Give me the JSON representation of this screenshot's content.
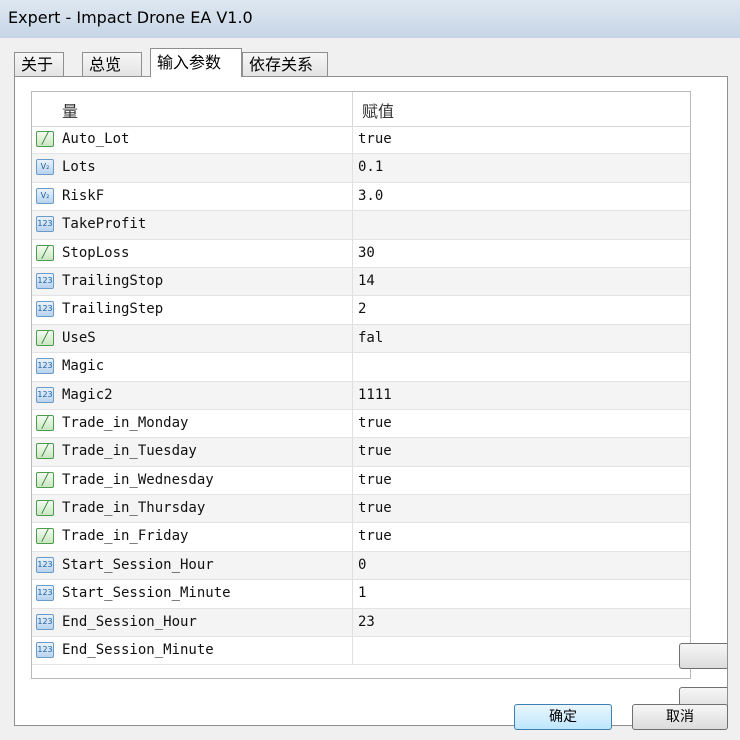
{
  "window": {
    "title": "Expert - Impact Drone EA V1.0"
  },
  "tabs": [
    {
      "label": "关于"
    },
    {
      "label": "总览"
    },
    {
      "label": "输入参数"
    },
    {
      "label": "依存关系"
    }
  ],
  "grid": {
    "header_name": "量",
    "header_value": "赋值",
    "rows": [
      {
        "icon": "bool",
        "name": "Auto_Lot",
        "value": "true"
      },
      {
        "icon": "double",
        "name": "Lots",
        "value": "0.1"
      },
      {
        "icon": "double",
        "name": "RiskF",
        "value": "3.0"
      },
      {
        "icon": "int",
        "name": "TakeProfit",
        "value": ""
      },
      {
        "icon": "bool",
        "name": "StopLoss",
        "value": "30"
      },
      {
        "icon": "int",
        "name": "TrailingStop",
        "value": "14"
      },
      {
        "icon": "int",
        "name": "TrailingStep",
        "value": "2"
      },
      {
        "icon": "bool",
        "name": "UseS",
        "value": "fal"
      },
      {
        "icon": "int",
        "name": "Magic",
        "value": ""
      },
      {
        "icon": "int",
        "name": "Magic2",
        "value": "1111"
      },
      {
        "icon": "bool",
        "name": "Trade_in_Monday",
        "value": "true"
      },
      {
        "icon": "bool",
        "name": "Trade_in_Tuesday",
        "value": "true"
      },
      {
        "icon": "bool",
        "name": "Trade_in_Wednesday",
        "value": "true"
      },
      {
        "icon": "bool",
        "name": "Trade_in_Thursday",
        "value": "true"
      },
      {
        "icon": "bool",
        "name": "Trade_in_Friday",
        "value": "true"
      },
      {
        "icon": "int",
        "name": "Start_Session_Hour",
        "value": "0"
      },
      {
        "icon": "int",
        "name": "Start_Session_Minute",
        "value": "1"
      },
      {
        "icon": "int",
        "name": "End_Session_Hour",
        "value": "23"
      },
      {
        "icon": "int",
        "name": "End_Session_Minute",
        "value": ""
      }
    ]
  },
  "buttons": {
    "ok": "确定",
    "cancel": "取消"
  }
}
